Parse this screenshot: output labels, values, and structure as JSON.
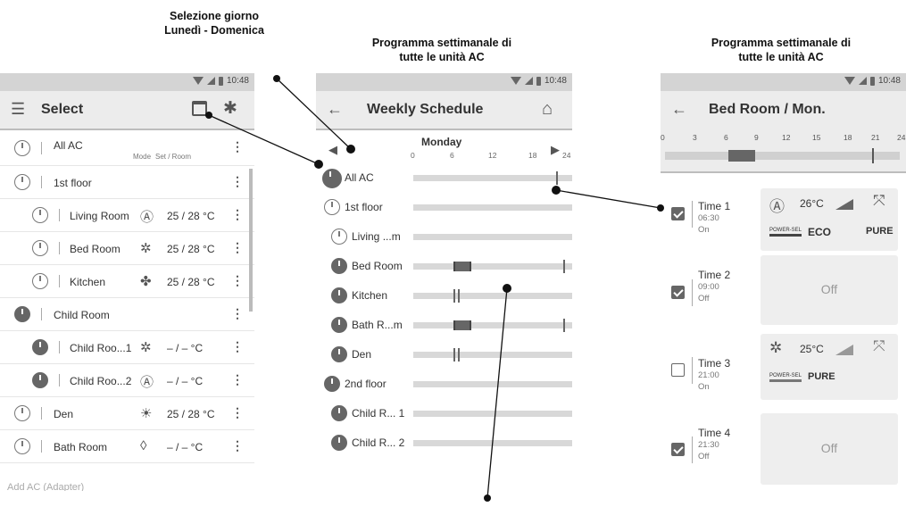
{
  "annotations": {
    "day_select_line1": "Selezione giorno",
    "day_select_line2": "Lunedì - Domenica",
    "weekly_all_line1": "Programma settimanale di",
    "weekly_all_line2": "tutte le unità AC",
    "weekly_all2_line1": "Programma settimanale di",
    "weekly_all2_line2": "tutte le unità AC"
  },
  "status": {
    "time": "10:48"
  },
  "screen1": {
    "title": "Select",
    "all_ac_label": "All AC",
    "mode_header": "Mode",
    "setroom_header": "Set / Room",
    "rows": [
      {
        "label": "1st floor"
      },
      {
        "label": "Living Room",
        "mode_icon": "Ⓐ",
        "set": "25 / 28 °C"
      },
      {
        "label": "Bed Room",
        "mode_icon": "✲",
        "set": "25 / 28 °C"
      },
      {
        "label": "Kitchen",
        "mode_icon": "✤",
        "set": "25 / 28 °C"
      },
      {
        "label": "Child Room"
      },
      {
        "label": "Child Roo...1",
        "mode_icon": "✲",
        "set": "– / –   °C"
      },
      {
        "label": "Child Roo...2",
        "mode_icon": "Ⓐ",
        "set": "– / –   °C"
      },
      {
        "label": "Den",
        "mode_icon": "☀",
        "set": "25 / 28 °C"
      },
      {
        "label": "Bath Room",
        "mode_icon": "◊",
        "set": "– / –   °C"
      }
    ],
    "add_ac": "Add AC (Adapter)"
  },
  "screen2": {
    "title": "Weekly Schedule",
    "day": "Monday",
    "ticks": [
      "0",
      "6",
      "12",
      "18",
      "24"
    ],
    "rows": [
      {
        "label": "All AC"
      },
      {
        "label": "1st floor"
      },
      {
        "label": "Living ...m"
      },
      {
        "label": "Bed Room"
      },
      {
        "label": "Kitchen"
      },
      {
        "label": "Bath R...m"
      },
      {
        "label": "Den"
      },
      {
        "label": "2nd floor"
      },
      {
        "label": "Child R... 1"
      },
      {
        "label": "Child R... 2"
      }
    ]
  },
  "screen3": {
    "title": "Bed Room / Mon.",
    "ticks": [
      "0",
      "3",
      "6",
      "9",
      "12",
      "15",
      "18",
      "21",
      "24"
    ],
    "entries": [
      {
        "name": "Time 1",
        "time": "06:30",
        "state": "On",
        "temp": "26°C",
        "power": "POWER-SEL",
        "eco": "ECO",
        "pure": "PURE",
        "mode_icon": "Ⓐ"
      },
      {
        "name": "Time 2",
        "time": "09:00",
        "state": "Off",
        "card_off": "Off"
      },
      {
        "name": "Time 3",
        "time": "21:00",
        "state": "On",
        "temp": "25°C",
        "power": "POWER-SEL",
        "pure": "PURE",
        "mode_icon": "✲"
      },
      {
        "name": "Time 4",
        "time": "21:30",
        "state": "Off",
        "card_off": "Off"
      }
    ]
  }
}
